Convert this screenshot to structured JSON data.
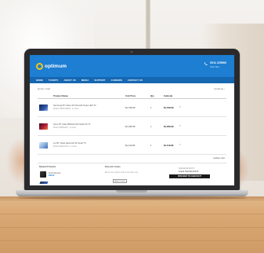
{
  "site": {
    "logo_text": "optimum",
    "phone": "0011 225566",
    "hours": "Mon-Sat",
    "nav": [
      "HOME",
      "TV/HDTV",
      "ABOUT US",
      "MEDIA",
      "SUPPORT",
      "CAREERS",
      "CONTACT US"
    ]
  },
  "cart": {
    "breadcrumb": "Home / Cart",
    "continue_label": "Continue ›",
    "headers": {
      "product": "Product Name",
      "price": "Unit Price",
      "qty": "Qty",
      "subtotal": "Subtotal"
    },
    "items": [
      {
        "name": "Samsung 65\" Class 4K Ultra HD Smart LED TV",
        "sub": "Model UN65TU8000 · In stock",
        "price": "$1,799.99",
        "qty": "1",
        "subtotal": "$1,799.99"
      },
      {
        "name": "Sony 55\" Class BRAVIA XR OLED 4K TV",
        "sub": "Model XR55A80J · In stock",
        "price": "$1,299.99",
        "qty": "1",
        "subtotal": "$1,299.99"
      },
      {
        "name": "LG 65\" Class NanoCell 4K Smart TV",
        "sub": "Model 65NANO75 · In stock",
        "price": "$1,119.99",
        "qty": "1",
        "subtotal": "$1,119.99"
      }
    ],
    "update_label": "Update Cart",
    "also_title": "Related Products",
    "rec1_name": "Smart Remote",
    "rec1_price": "$49.99",
    "coupon_title": "Discount Codes",
    "coupon_text": "Enter your coupon code if you have one",
    "coupon_btn": "Apply Coupon",
    "totals_label": "Subtotal $4,219.97",
    "totals_value": "Grand Total $4,219.97",
    "checkout_label": "PROCEED TO CHECKOUT"
  }
}
